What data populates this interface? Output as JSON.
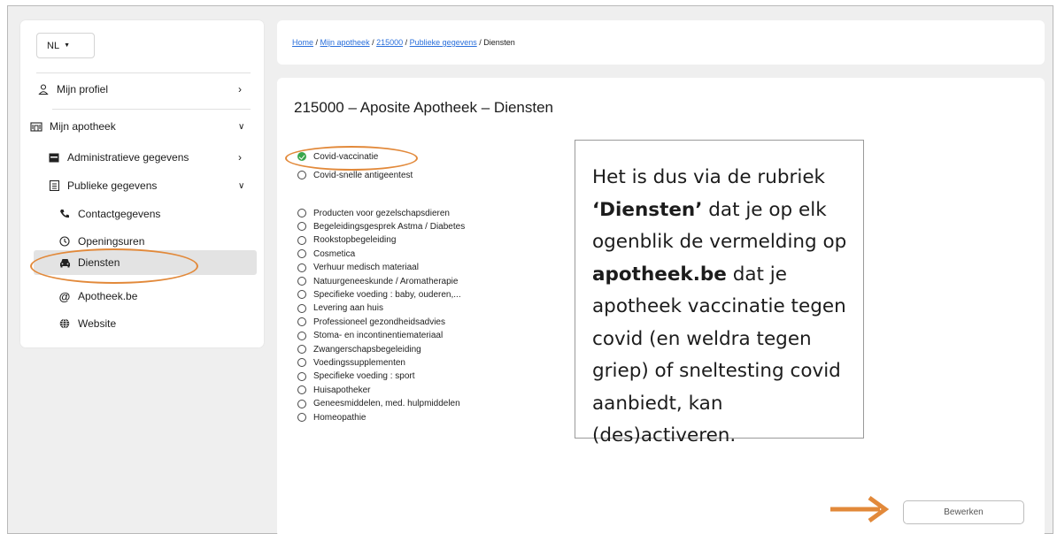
{
  "sidebar": {
    "language": "NL",
    "items": [
      {
        "label": "Mijn profiel",
        "icon": "user-icon",
        "arrow": ">"
      },
      {
        "label": "Mijn apotheek",
        "icon": "building-icon",
        "arrow": "v"
      },
      {
        "label": "Administratieve gegevens",
        "icon": "inbox-icon",
        "arrow": ">"
      },
      {
        "label": "Publieke gegevens",
        "icon": "list-icon",
        "arrow": "v"
      },
      {
        "label": "Contactgegevens",
        "icon": "phone-icon"
      },
      {
        "label": "Openingsuren",
        "icon": "clock-icon"
      },
      {
        "label": "Diensten",
        "icon": "car-icon",
        "active": true
      },
      {
        "label": "Apotheek.be",
        "icon": "at-icon"
      },
      {
        "label": "Website",
        "icon": "globe-icon"
      }
    ]
  },
  "breadcrumb": {
    "home": "Home",
    "sep": " / ",
    "mijn_apotheek": "Mijn apotheek",
    "id": "215000",
    "publieke": "Publieke gegevens",
    "current": "Diensten"
  },
  "main": {
    "title": "215000 – Aposite Apotheek – Diensten",
    "services": [
      {
        "label": "Covid-vaccinatie",
        "checked": true
      },
      {
        "label": "Covid-snelle antigeentest",
        "checked": false
      },
      {
        "label": "Producten voor gezelschapsdieren",
        "checked": false
      },
      {
        "label": "Begeleidingsgesprek Astma / Diabetes",
        "checked": false
      },
      {
        "label": "Rookstopbegeleiding",
        "checked": false
      },
      {
        "label": "Cosmetica",
        "checked": false
      },
      {
        "label": "Verhuur medisch materiaal",
        "checked": false
      },
      {
        "label": "Natuurgeneeskunde / Aromatherapie",
        "checked": false
      },
      {
        "label": "Specifieke voeding : baby, ouderen,...",
        "checked": false
      },
      {
        "label": "Levering aan huis",
        "checked": false
      },
      {
        "label": "Professioneel gezondheidsadvies",
        "checked": false
      },
      {
        "label": "Stoma- en incontinentiemateriaal",
        "checked": false
      },
      {
        "label": "Zwangerschapsbegeleiding",
        "checked": false
      },
      {
        "label": "Voedingssupplementen",
        "checked": false
      },
      {
        "label": "Specifieke voeding : sport",
        "checked": false
      },
      {
        "label": "Huisapotheker",
        "checked": false
      },
      {
        "label": "Geneesmiddelen, med. hulpmiddelen",
        "checked": false
      },
      {
        "label": "Homeopathie",
        "checked": false
      }
    ],
    "edit_button": "Bewerken"
  },
  "callout": {
    "part1": "Het is dus via de rubriek ",
    "bold1": "‘Diensten’",
    "part2": " dat je op elk ogenblik de vermelding op ",
    "bold2": "apotheek.be",
    "part3": " dat je apotheek vaccinatie tegen covid (en weldra tegen griep) of sneltesting covid aanbiedt, kan (des)activeren."
  },
  "colors": {
    "highlight": "#e2893a",
    "link": "#2a6fdb",
    "checked": "#3aa64c"
  }
}
